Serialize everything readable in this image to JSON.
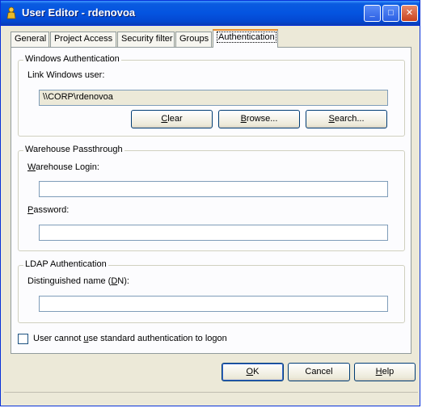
{
  "window": {
    "title": "User Editor - rdenovoa"
  },
  "title_buttons": {
    "minimize": "_",
    "maximize": "□",
    "close": "✕"
  },
  "tabs": [
    {
      "label": "General"
    },
    {
      "label": "Project Access"
    },
    {
      "label": "Security filter"
    },
    {
      "label": "Groups"
    },
    {
      "label": "Authentication"
    }
  ],
  "windows_auth": {
    "title": "Windows Authentication",
    "link_label": "Link Windows user:",
    "link_value": "\\\\CORP\\rdenovoa",
    "clear_label": "Clear",
    "browse_label": "Browse...",
    "search_label": "Search..."
  },
  "warehouse": {
    "title": "Warehouse Passthrough",
    "login_label": "Warehouse Login:",
    "login_value": "",
    "password_label": "Password:",
    "password_value": ""
  },
  "ldap": {
    "title": "LDAP Authentication",
    "dn_label": "Distinguished name (DN):",
    "dn_value": ""
  },
  "standard_auth": {
    "label": "User cannot use standard authentication to logon",
    "checked": false
  },
  "buttons": {
    "ok": "OK",
    "cancel": "Cancel",
    "help": "Help"
  }
}
